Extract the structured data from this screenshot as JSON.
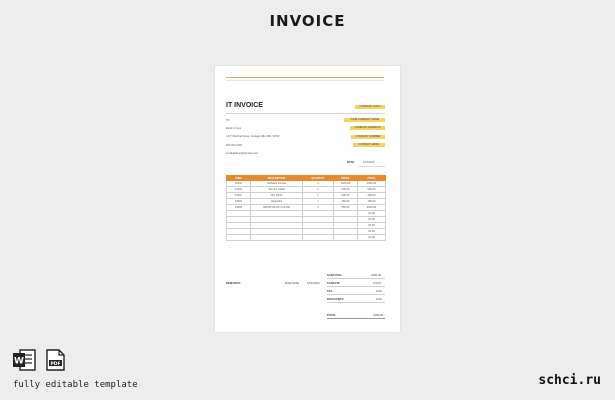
{
  "page": {
    "title": "INVOICE",
    "caption": "fully editable template",
    "brand": "schci.ru"
  },
  "invoice": {
    "title": "IT INVOICE",
    "company_logo": "COMPANY LOGO",
    "to_label": "TO:",
    "company_name": "YOUR COMPANY NAME",
    "client_name": "Elrod F. Foss",
    "company_address": "COMPANY ADDRESS",
    "client_address": "1377 Marshal Street, Cottage Hills, MO, 31547",
    "company_number": "COMPANY NUMBER",
    "client_phone": "000-000-0000",
    "company_email": "COMPANY EMAIL",
    "client_email": "emailaddress@domain.com",
    "date_label": "DATE:",
    "date_value": "1/01/2020"
  },
  "table": {
    "headers": [
      "ITEM",
      "DESCRIPTION",
      "QUANTITY",
      "PRICE",
      "TOTAL"
    ],
    "rows": [
      [
        "10001",
        "Software license",
        "1",
        "1000.00",
        "1000.00"
      ],
      [
        "10001",
        "Service install",
        "1",
        "500.00",
        "500.00"
      ],
      [
        "10001",
        "CD/ DATA",
        "1",
        "300.00",
        "300.00"
      ],
      [
        "10001",
        "Upgrades",
        "1",
        "150.00",
        "150.00"
      ],
      [
        "10002",
        "MONITOR OF COLOR",
        "4",
        "550.00",
        "2200.00"
      ],
      [
        "",
        "",
        "",
        "",
        "00.00"
      ],
      [
        "",
        "",
        "",
        "",
        "00.00"
      ],
      [
        "",
        "",
        "",
        "",
        "00.00"
      ],
      [
        "",
        "",
        "",
        "",
        "00.00"
      ],
      [
        "",
        "",
        "",
        "",
        "00.00"
      ]
    ]
  },
  "totals": {
    "subtotal_label": "SUBTOTAL",
    "subtotal_value": "4150.00",
    "remarks_label": "REMARKS:",
    "due_date_label": "DUE DATE",
    "due_date_value": "1/01/2020",
    "taxrate_label": "TAXRATE",
    "taxrate_value": "0.00%",
    "tax_label": "TAX",
    "tax_value": "0.00",
    "discount_label": "DISCOUNTS",
    "discount_value": "0.00",
    "total_label": "TOTAL",
    "total_value": "4150.00"
  },
  "icons": {
    "word": "word-document-icon",
    "pdf": "pdf-document-icon",
    "word_letter": "W",
    "pdf_text": "PDF"
  },
  "colors": {
    "accent": "#e8892b",
    "highlight": "#f6d460",
    "background": "#ededed"
  }
}
